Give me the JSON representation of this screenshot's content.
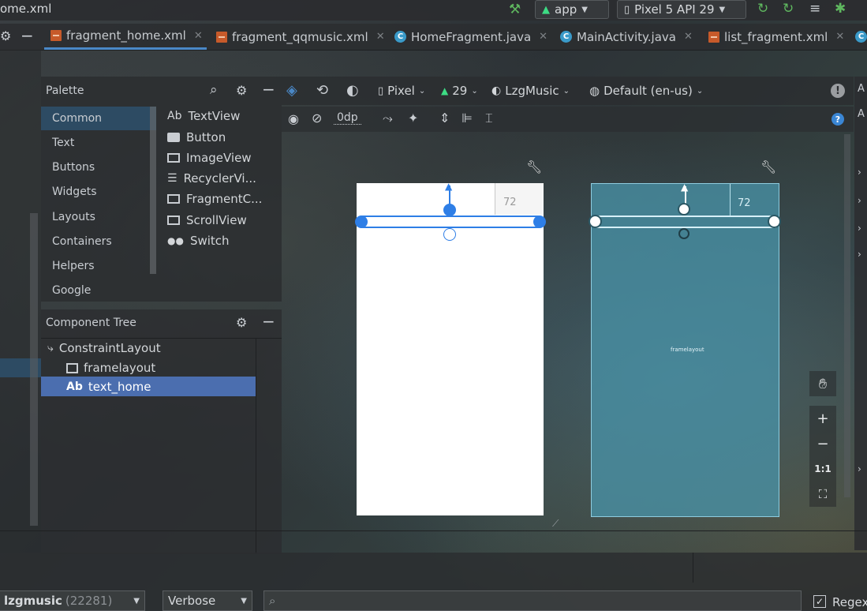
{
  "topbar": {
    "file_crumb": "ome.xml",
    "run_config": "app",
    "device": "Pixel 5 API 29"
  },
  "tabs": [
    {
      "label": "fragment_home.xml"
    },
    {
      "label": "fragment_qqmusic.xml"
    },
    {
      "label": "HomeFragment.java"
    },
    {
      "label": "MainActivity.java"
    },
    {
      "label": "list_fragment.xml"
    }
  ],
  "palette": {
    "title": "Palette",
    "categories": [
      "Common",
      "Text",
      "Buttons",
      "Widgets",
      "Layouts",
      "Containers",
      "Helpers",
      "Google"
    ],
    "items": [
      "TextView",
      "Button",
      "ImageView",
      "RecyclerVi...",
      "FragmentC...",
      "ScrollView",
      "Switch"
    ],
    "textview_prefix": "Ab"
  },
  "component_tree": {
    "title": "Component Tree",
    "nodes": [
      "ConstraintLayout",
      "framelayout",
      "text_home"
    ],
    "text_prefix": "Ab"
  },
  "design_toolbar": {
    "device": "Pixel",
    "api": "29",
    "theme": "LzgMusic",
    "locale": "Default (en-us)",
    "margin": "0dp"
  },
  "canvas": {
    "margin_label": "72",
    "blueprint_label": "framelayout"
  },
  "zoom": {
    "plus": "+",
    "minus": "−",
    "one_to_one": "1:1"
  },
  "logcat": {
    "process": "lzgmusic",
    "pid": "(22281)",
    "level": "Verbose",
    "regex_label": "Regex"
  },
  "colors": {
    "accent": "#4a88c7",
    "selection": "#4b6eaf",
    "blueprint": "#4994aa",
    "android_green": "#3ddc84"
  }
}
